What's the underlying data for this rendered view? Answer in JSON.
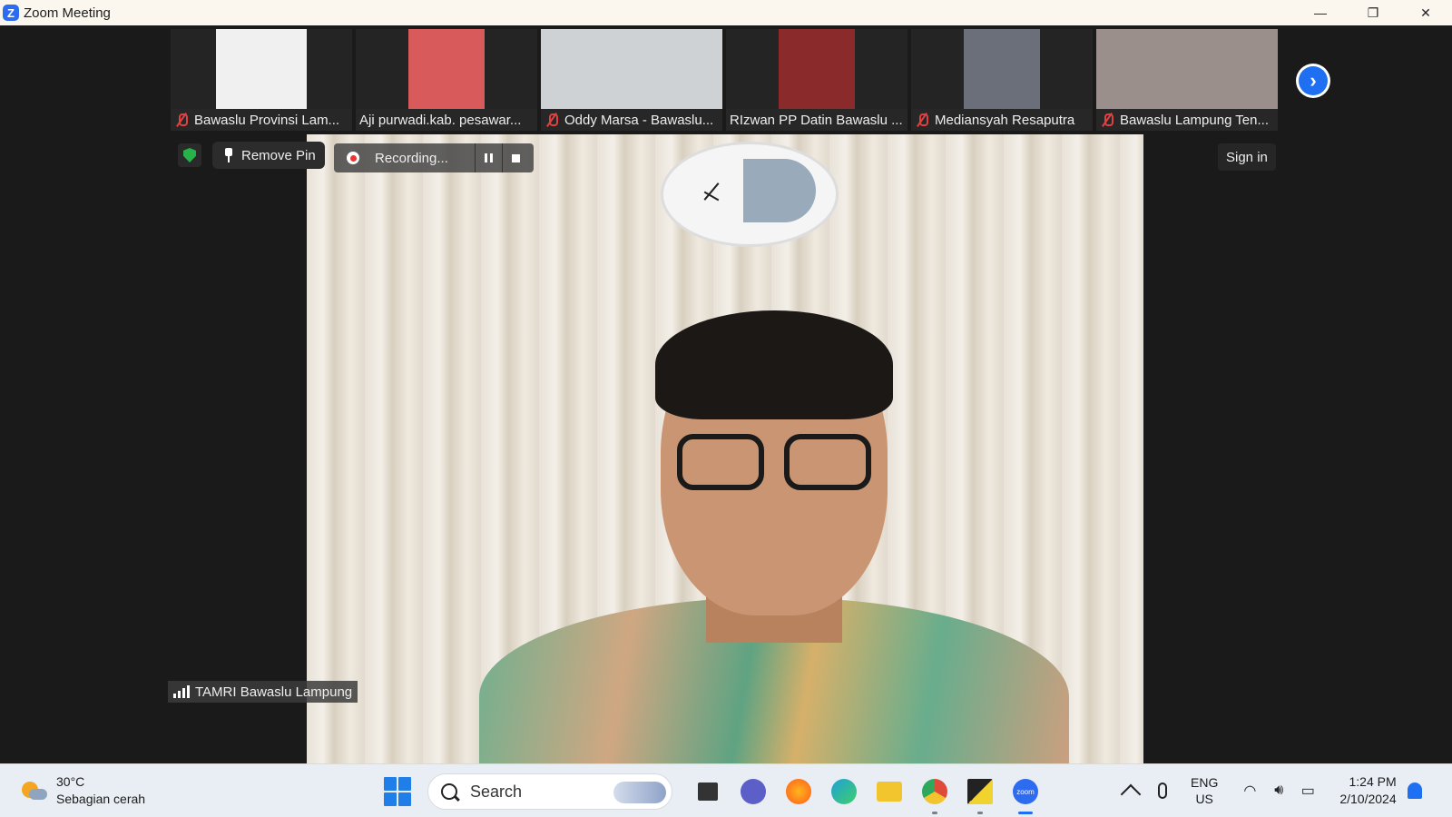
{
  "window": {
    "title": "Zoom Meeting",
    "logo": "Z",
    "minimize": "—",
    "restore": "❐",
    "close": "✕"
  },
  "participants": [
    {
      "name": "Bawaslu Provinsi Lam...",
      "muted": true,
      "color": "#f0f0f0"
    },
    {
      "name": "Aji purwadi.kab. pesawar...",
      "muted": false,
      "color": "#d85a5a"
    },
    {
      "name": "Oddy Marsa - Bawaslu...",
      "muted": true,
      "color": "#cfd2d4"
    },
    {
      "name": "RIzwan PP Datin Bawaslu ...",
      "muted": false,
      "color": "#8a2a2a"
    },
    {
      "name": "Mediansyah Resaputra",
      "muted": true,
      "color": "#6b6f7a"
    },
    {
      "name": "Bawaslu Lampung Ten...",
      "muted": true,
      "color": "#9a8f8a"
    }
  ],
  "controls": {
    "remove_pin": "Remove Pin",
    "recording": "Recording...",
    "sign_in": "Sign in",
    "active_speaker": "TAMRI Bawaslu Lampung"
  },
  "taskbar": {
    "weather_temp": "30°C",
    "weather_desc": "Sebagian cerah",
    "search_placeholder": "Search",
    "lang_line1": "ENG",
    "lang_line2": "US",
    "time": "1:24 PM",
    "date": "2/10/2024",
    "apps": [
      {
        "name": "task-view",
        "color": "#333333"
      },
      {
        "name": "meet",
        "color": "#5b5fc7"
      },
      {
        "name": "firefox",
        "color": "#ff7a1a"
      },
      {
        "name": "edge",
        "color": "#1fa0d8"
      },
      {
        "name": "file-explorer",
        "color": "#f2c42e"
      },
      {
        "name": "chrome",
        "color": "#e04a3a"
      },
      {
        "name": "sticky-notes",
        "color": "#222222"
      },
      {
        "name": "zoom",
        "color": "#2d6bf0",
        "label": "zoom"
      }
    ]
  }
}
